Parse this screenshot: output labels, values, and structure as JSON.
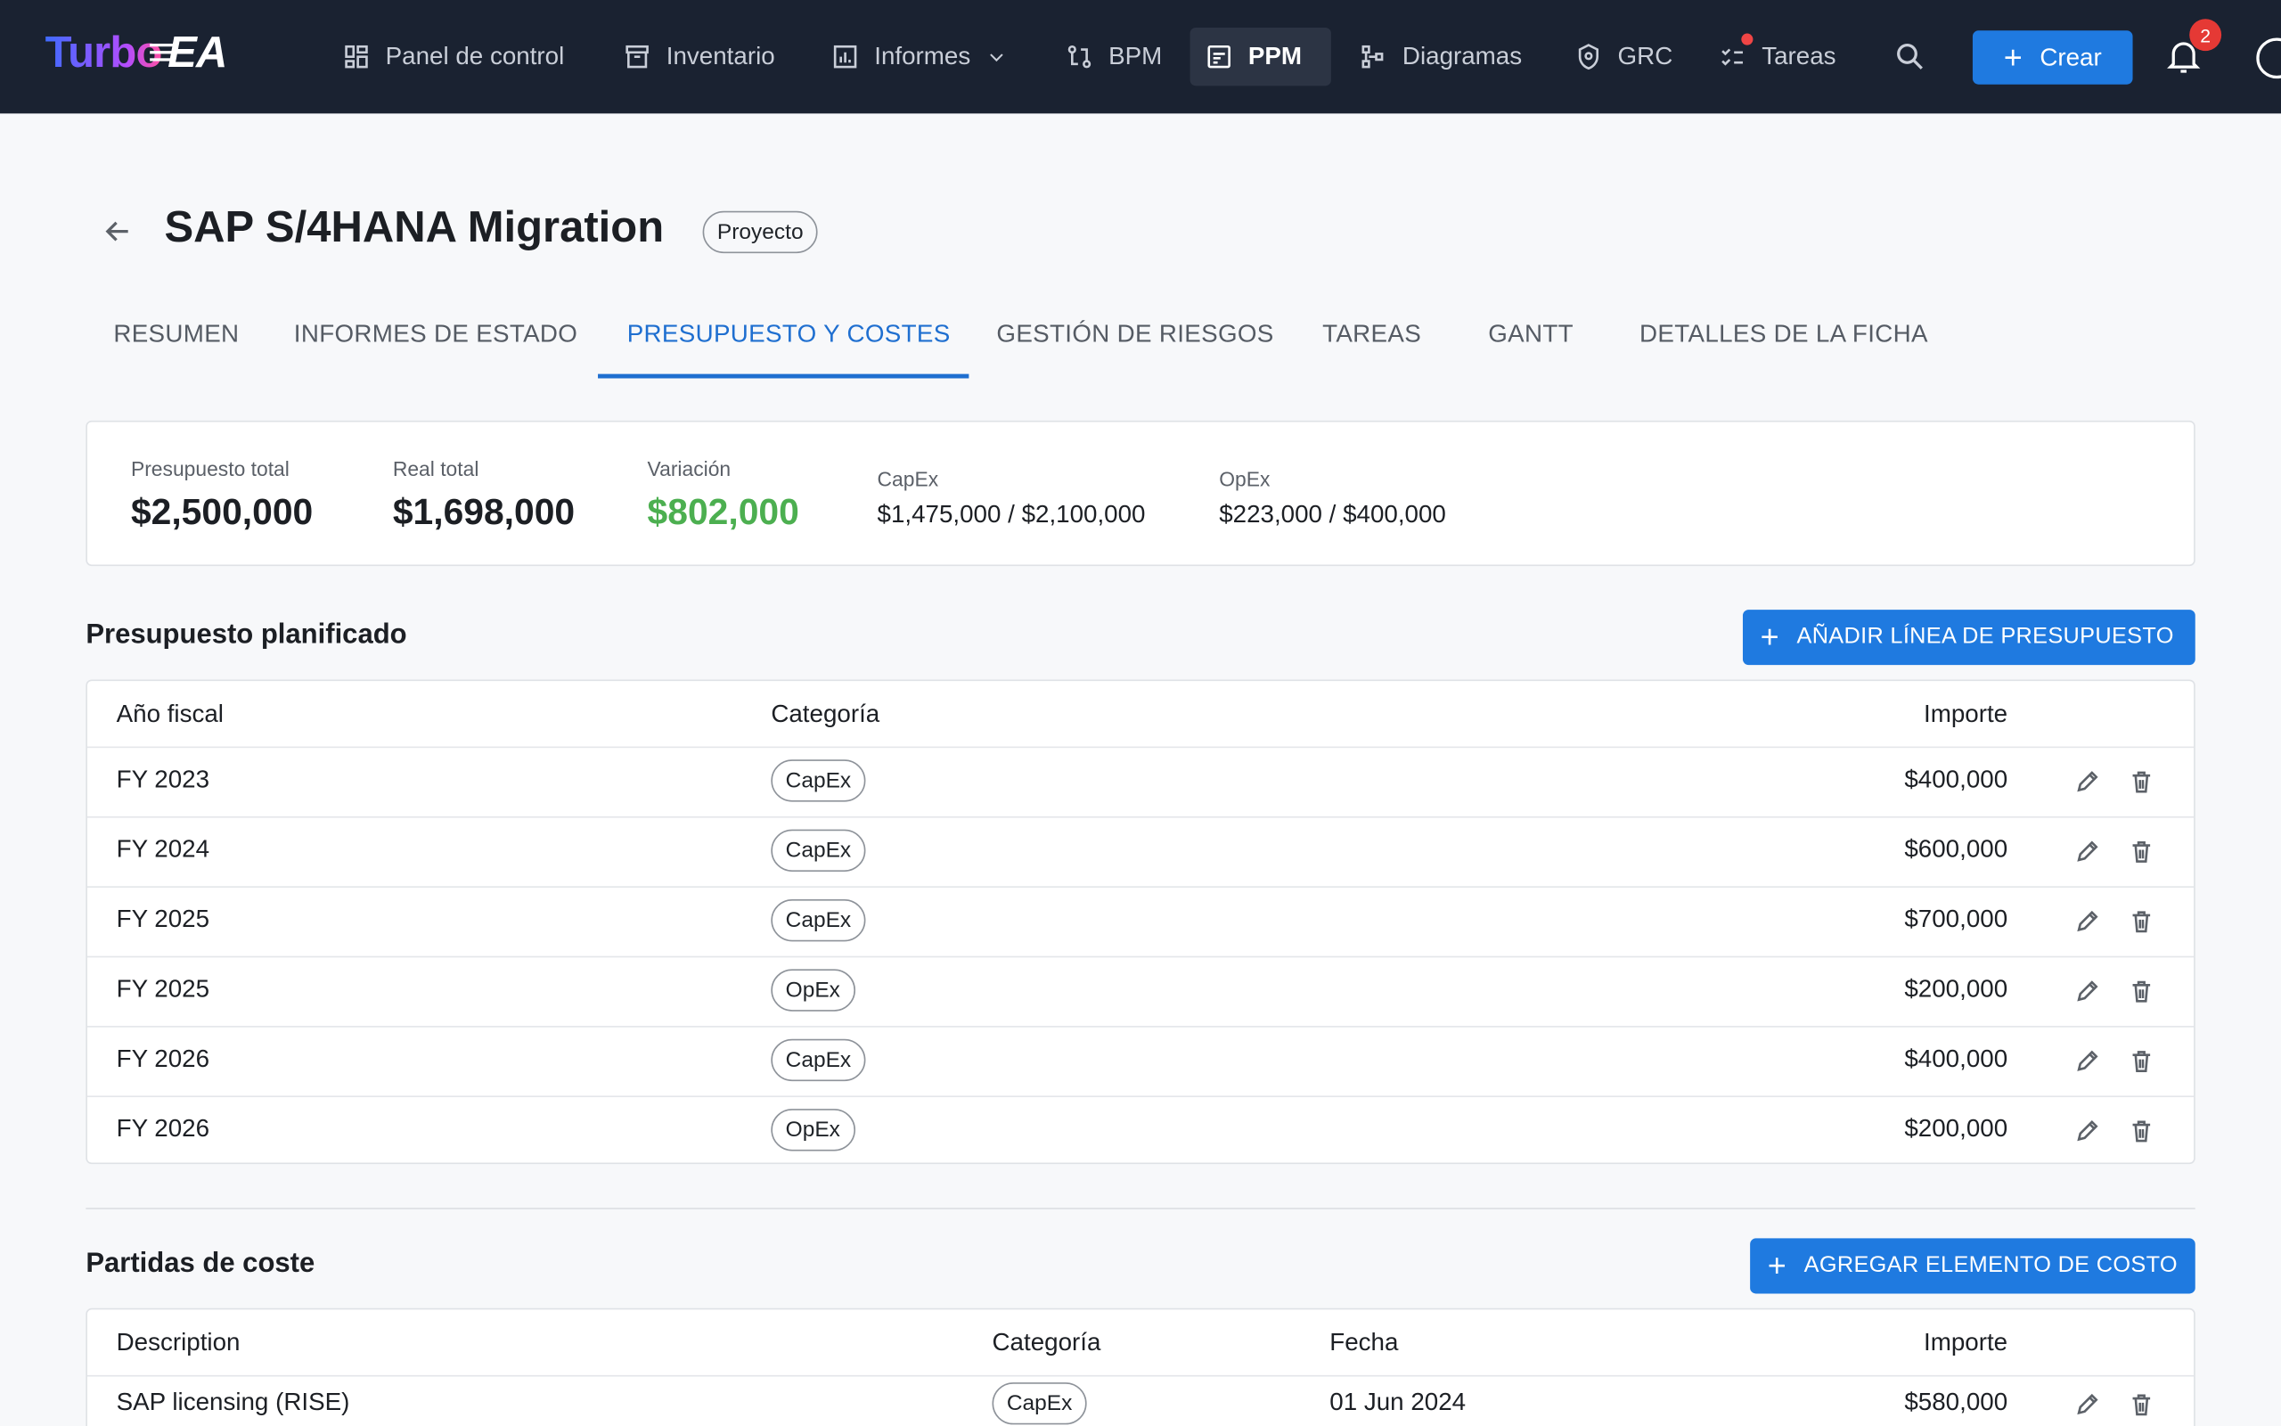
{
  "nav": {
    "logo_a": "Turbo",
    "logo_b": "EA",
    "items": [
      {
        "label": "Panel de control",
        "icon": "dashboard-icon"
      },
      {
        "label": "Inventario",
        "icon": "archive-icon"
      },
      {
        "label": "Informes",
        "icon": "chart-icon"
      },
      {
        "label": "BPM",
        "icon": "bpm-icon"
      },
      {
        "label": "PPM",
        "icon": "ppm-icon"
      },
      {
        "label": "Diagramas",
        "icon": "diagram-icon"
      },
      {
        "label": "GRC",
        "icon": "shield-icon"
      },
      {
        "label": "Tareas",
        "icon": "tasks-icon"
      }
    ],
    "create_label": "Crear",
    "notification_count": "2"
  },
  "header": {
    "title": "SAP S/4HANA Migration",
    "type_chip": "Proyecto"
  },
  "tabs": [
    "RESUMEN",
    "INFORMES DE ESTADO",
    "PRESUPUESTO Y COSTES",
    "GESTIÓN DE RIESGOS",
    "TAREAS",
    "GANTT",
    "DETALLES DE LA FICHA"
  ],
  "summary": {
    "budget_label": "Presupuesto total",
    "budget_value": "$2,500,000",
    "actual_label": "Real total",
    "actual_value": "$1,698,000",
    "variance_label": "Variación",
    "variance_value": "$802,000",
    "capex_label": "CapEx",
    "capex_value": "$1,475,000 / $2,100,000",
    "opex_label": "OpEx",
    "opex_value": "$223,000 / $400,000",
    "variance_color": "#4caf50"
  },
  "budget": {
    "title": "Presupuesto planificado",
    "add_label": "AÑADIR LÍNEA DE PRESUPUESTO",
    "headers": {
      "year": "Año fiscal",
      "category": "Categoría",
      "amount": "Importe"
    },
    "rows": [
      {
        "year": "FY 2023",
        "category": "CapEx",
        "amount": "$400,000"
      },
      {
        "year": "FY 2024",
        "category": "CapEx",
        "amount": "$600,000"
      },
      {
        "year": "FY 2025",
        "category": "CapEx",
        "amount": "$700,000"
      },
      {
        "year": "FY 2025",
        "category": "OpEx",
        "amount": "$200,000"
      },
      {
        "year": "FY 2026",
        "category": "CapEx",
        "amount": "$400,000"
      },
      {
        "year": "FY 2026",
        "category": "OpEx",
        "amount": "$200,000"
      }
    ]
  },
  "costs": {
    "title": "Partidas de coste",
    "add_label": "AGREGAR ELEMENTO DE COSTO",
    "headers": {
      "description": "Description",
      "category": "Categoría",
      "date": "Fecha",
      "amount": "Importe"
    },
    "rows": [
      {
        "description": "SAP licensing (RISE)",
        "category": "CapEx",
        "date": "01 Jun 2024",
        "amount": "$580,000"
      }
    ]
  }
}
